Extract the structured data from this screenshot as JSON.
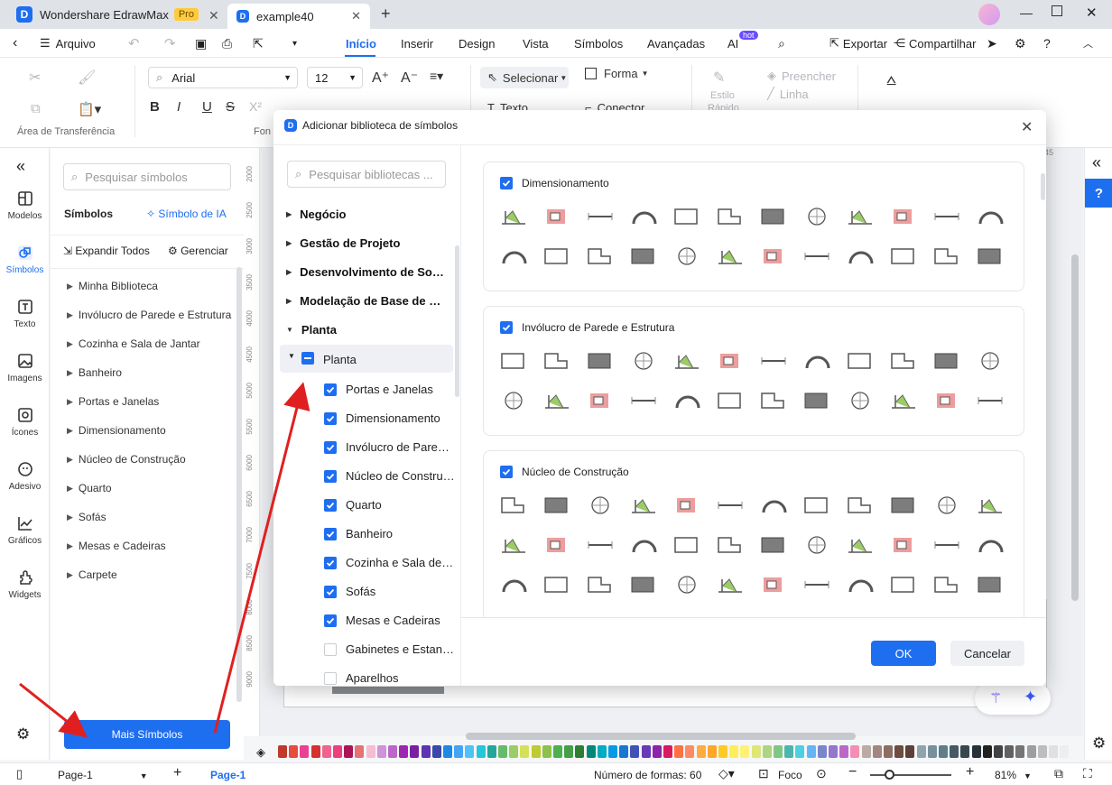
{
  "app": {
    "name": "Wondershare EdrawMax",
    "badge": "Pro",
    "doc_tab": "example40"
  },
  "menu": {
    "file": "Arquivo",
    "tabs": [
      "Início",
      "Inserir",
      "Design",
      "Vista",
      "Símbolos",
      "Avançadas",
      "AI"
    ],
    "ai_badge": "hot",
    "export": "Exportar",
    "share": "Compartilhar"
  },
  "ribbon": {
    "font_name": "Arial",
    "font_size": "12",
    "clipboard_label": "Área de Transferência",
    "font_group_label": "Fon",
    "select": "Selecionar",
    "shape": "Forma",
    "text": "Texto",
    "connector": "Conector",
    "style_label": "Estilo",
    "style_label2": "Rápido",
    "fill": "Preencher",
    "line": "Linha",
    "accent_color": "#1e6ef0"
  },
  "leftbar": {
    "items": [
      {
        "label": "Modelos",
        "icon": "templates-icon"
      },
      {
        "label": "Símbolos",
        "icon": "symbols-icon"
      },
      {
        "label": "Texto",
        "icon": "text-icon"
      },
      {
        "label": "Imagens",
        "icon": "images-icon"
      },
      {
        "label": "Ícones",
        "icon": "icons-icon"
      },
      {
        "label": "Adesivo",
        "icon": "sticker-icon"
      },
      {
        "label": "Gráficos",
        "icon": "charts-icon"
      },
      {
        "label": "Widgets",
        "icon": "widgets-icon"
      }
    ]
  },
  "sympanel": {
    "search_placeholder": "Pesquisar símbolos",
    "title": "Símbolos",
    "ai_symbol": "Símbolo de IA",
    "expand_all": "Expandir Todos",
    "manage": "Gerenciar",
    "libraries": [
      "Minha Biblioteca",
      "Invólucro de Parede e Estrutura",
      "Cozinha e Sala de Jantar",
      "Banheiro",
      "Portas e Janelas",
      "Dimensionamento",
      "Núcleo de Construção",
      "Quarto",
      "Sofás",
      "Mesas e Cadeiras",
      "Carpete"
    ],
    "more_symbols": "Mais Símbolos"
  },
  "ruler": {
    "ticks": [
      "2000",
      "2500",
      "3000",
      "3500",
      "4000",
      "4500",
      "5000",
      "5500",
      "6000",
      "6500",
      "7000",
      "7500",
      "8000",
      "8500",
      "9000"
    ],
    "top_tick": "145"
  },
  "dialog": {
    "title": "Adicionar biblioteca de símbolos",
    "search_placeholder": "Pesquisar bibliotecas ...",
    "categories": [
      "Negócio",
      "Gestão de Projeto",
      "Desenvolvimento de Software",
      "Modelação de Base de Dados",
      "Planta"
    ],
    "subgroup": "Planta",
    "items": [
      {
        "label": "Portas e Janelas",
        "checked": true
      },
      {
        "label": "Dimensionamento",
        "checked": true
      },
      {
        "label": "Invólucro de Parede e Estrutura",
        "checked": true
      },
      {
        "label": "Núcleo de Construção",
        "checked": true
      },
      {
        "label": "Quarto",
        "checked": true
      },
      {
        "label": "Banheiro",
        "checked": true
      },
      {
        "label": "Cozinha e Sala de Jantar",
        "checked": true
      },
      {
        "label": "Sofás",
        "checked": true
      },
      {
        "label": "Mesas e Cadeiras",
        "checked": true
      },
      {
        "label": "Gabinetes e Estantes",
        "checked": false
      },
      {
        "label": "Aparelhos",
        "checked": false
      }
    ],
    "sections": [
      "Dimensionamento",
      "Invólucro de Parede e Estrutura",
      "Núcleo de Construção"
    ],
    "ok": "OK",
    "cancel": "Cancelar"
  },
  "status": {
    "page_select": "Page-1",
    "page_tab": "Page-1",
    "shape_count": "Número de formas: 60",
    "focus": "Foco",
    "zoom": "81%"
  },
  "palette": [
    "#c0392b",
    "#e74c3c",
    "#e84393",
    "#d63031",
    "#f06292",
    "#ec407a",
    "#ad1457",
    "#e57373",
    "#f8bbd0",
    "#ce93d8",
    "#ba68c8",
    "#9c27b0",
    "#7b1fa2",
    "#5e35b1",
    "#3949ab",
    "#1e88e5",
    "#42a5f5",
    "#4fc3f7",
    "#26c6da",
    "#26a69a",
    "#66bb6a",
    "#9ccc65",
    "#d4e157",
    "#c0ca33",
    "#8bc34a",
    "#4caf50",
    "#43a047",
    "#2e7d32",
    "#00897b",
    "#00acc1",
    "#039be5",
    "#1976d2",
    "#3f51b5",
    "#673ab7",
    "#8e24aa",
    "#d81b60",
    "#ff7043",
    "#ff8a65",
    "#ffab40",
    "#ffa726",
    "#ffca28",
    "#ffee58",
    "#fff176",
    "#dce775",
    "#aed581",
    "#81c784",
    "#4db6ac",
    "#4dd0e1",
    "#64b5f6",
    "#7986cb",
    "#9575cd",
    "#ba68c8",
    "#f48fb1",
    "#bcaaa4",
    "#a1887f",
    "#8d6e63",
    "#6d4c41",
    "#5d4037",
    "#90a4ae",
    "#78909c",
    "#607d8b",
    "#455a64",
    "#37474f",
    "#263238",
    "#212121",
    "#424242",
    "#616161",
    "#757575",
    "#9e9e9e",
    "#bdbdbd",
    "#e0e0e0",
    "#eeeeee"
  ]
}
